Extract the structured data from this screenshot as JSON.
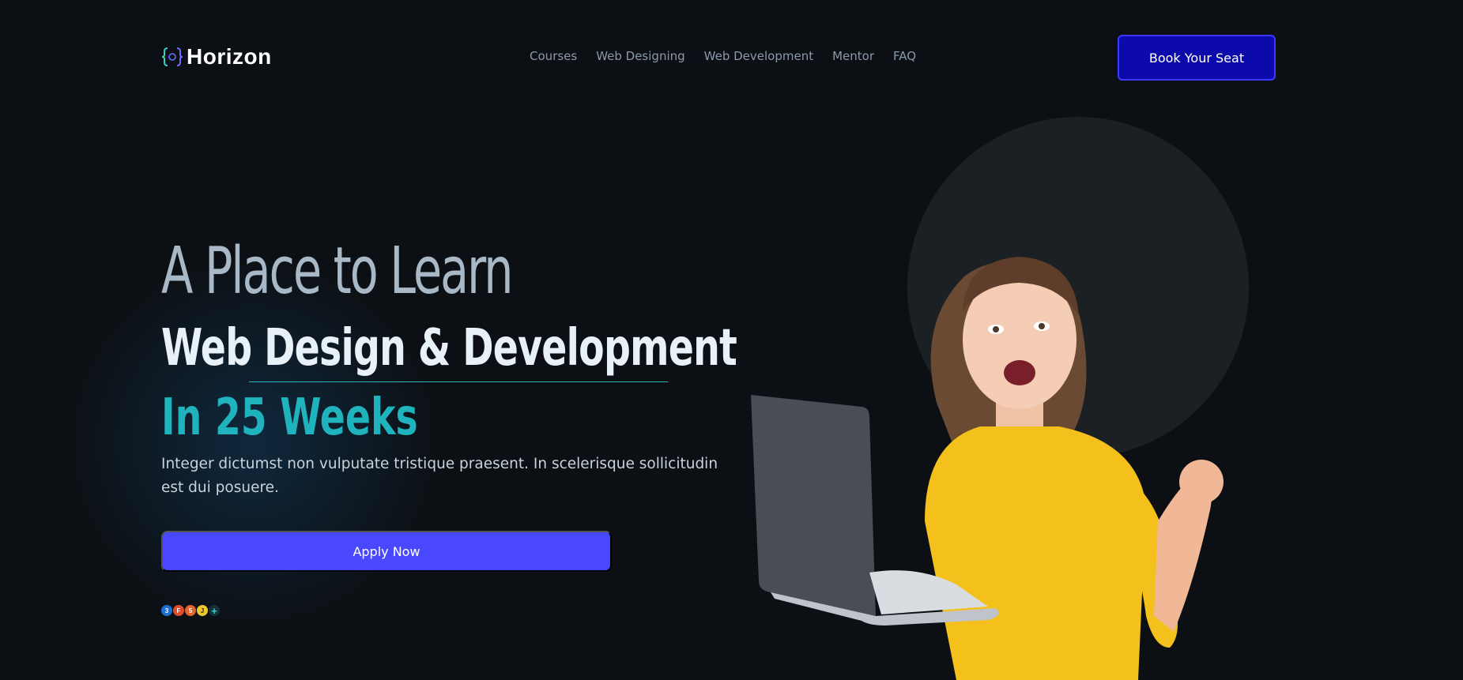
{
  "brand": {
    "name": "Horizon",
    "accent": "#2fd3c5"
  },
  "nav": {
    "items": [
      "Courses",
      "Web Designing",
      "Web Development",
      "Mentor",
      "FAQ"
    ]
  },
  "header": {
    "cta_label": "Book Your Seat"
  },
  "hero": {
    "line1": "A Place to Learn",
    "line2": "Web Design & Development",
    "line3": "In 25 Weeks",
    "description": "Integer dictumst non vulputate tristique praesent. In scelerisque sollicitudin est dui posuere.",
    "apply_label": "Apply Now",
    "tech_icons": [
      "css3-icon",
      "figma-icon",
      "html5-icon",
      "javascript-icon",
      "plus-icon"
    ]
  },
  "colors": {
    "background": "#0c1014",
    "primary_button": "#4a48ff",
    "header_button": "#0d0aab",
    "teal": "#1fb4bd"
  }
}
